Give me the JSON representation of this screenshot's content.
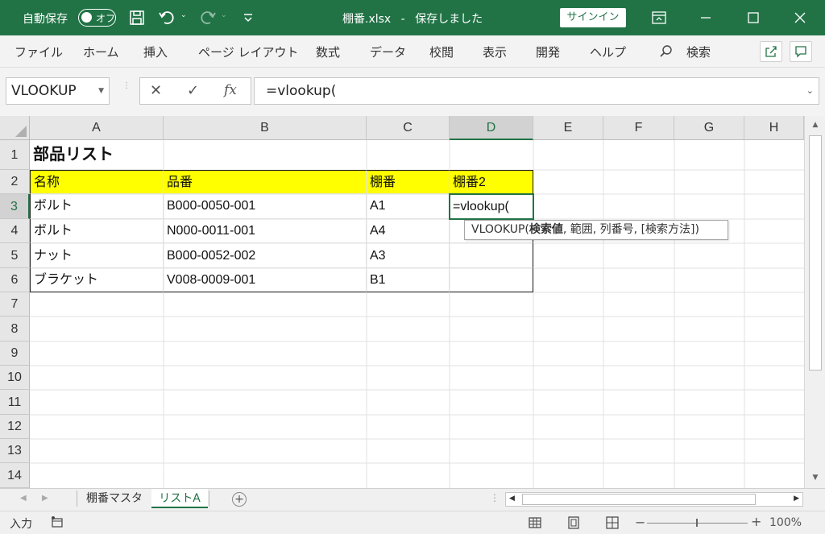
{
  "titlebar": {
    "autosave_label": "自動保存",
    "autosave_state": "オフ",
    "filename": "棚番.xlsx",
    "separator": "-",
    "save_status": "保存しました",
    "signin_label": "サインイン",
    "accent_color": "#217346"
  },
  "ribbon": {
    "tabs": [
      "ファイル",
      "ホーム",
      "挿入",
      "ページ レイアウト",
      "数式",
      "データ",
      "校閲",
      "表示",
      "開発",
      "ヘルプ"
    ],
    "search_label": "検索"
  },
  "formula_bar": {
    "name_box": "VLOOKUP",
    "formula": "=vlookup(",
    "fx": "fx"
  },
  "grid": {
    "columns": [
      "A",
      "B",
      "C",
      "D",
      "E",
      "F",
      "G",
      "H"
    ],
    "active_column": "D",
    "rows": [
      "1",
      "2",
      "3",
      "4",
      "5",
      "6",
      "7",
      "8",
      "9",
      "10",
      "11",
      "12",
      "13",
      "14"
    ],
    "active_row": "3",
    "cells": {
      "a1": "部品リスト",
      "a2": "名称",
      "b2": "品番",
      "c2": "棚番",
      "d2": "棚番2",
      "a3": "ボルト",
      "b3": "B000-0050-001",
      "c3": "A1",
      "d3": "=vlookup(",
      "a4": "ボルト",
      "b4": "N000-0011-001",
      "c4": "A4",
      "a5": "ナット",
      "b5": "B000-0052-002",
      "c5": "A3",
      "a6": "ブラケット",
      "b6": "V008-0009-001",
      "c6": "B1"
    },
    "header_fill_color": "#ffff00",
    "tooltip": {
      "func": "VLOOKUP(",
      "arg_bold": "検索値",
      "rest": ", 範囲, 列番号, [検索方法])"
    }
  },
  "sheets": {
    "tabs": [
      "棚番マスタ",
      "リストA"
    ],
    "active": "リストA"
  },
  "status": {
    "mode": "入力",
    "zoom": "100%"
  }
}
